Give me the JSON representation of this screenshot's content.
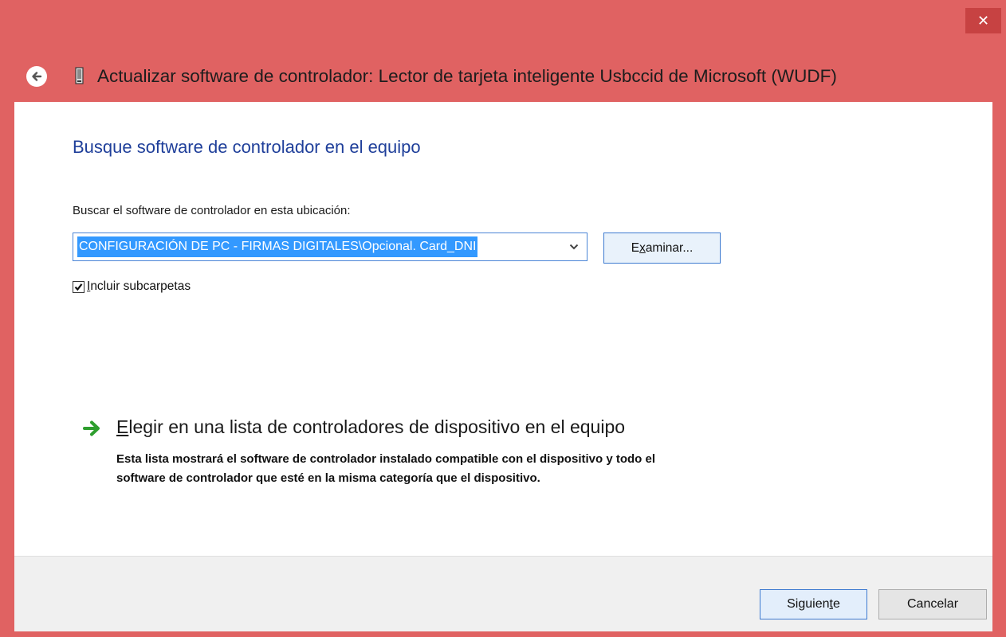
{
  "window": {
    "title": "Actualizar software de controlador: Lector de tarjeta inteligente Usbccid de Microsoft (WUDF)",
    "close_glyph": "✕",
    "back_icon": "back-arrow-icon",
    "device_icon": "smart-card-reader-icon",
    "accent_color": "#e06262"
  },
  "main": {
    "heading": "Busque software de controlador en el equipo",
    "location_label": "Buscar el software de controlador en esta ubicación:",
    "location_value": "CONFIGURACIÓN DE PC - FIRMAS DIGITALES\\Opcional. Card_DNI",
    "browse_button": {
      "pre": "E",
      "mnemonic": "x",
      "post": "aminar..."
    },
    "include_subfolders": {
      "checked": true,
      "mnemonic": "I",
      "post": "ncluir subcarpetas"
    },
    "pick_option": {
      "title_mnemonic": "E",
      "title_post": "legir en una lista de controladores de dispositivo en el equipo",
      "description_line1": "Esta lista mostrará el software de controlador instalado compatible con el dispositivo y todo el",
      "description_line2": "software de controlador que esté en la misma categoría que el dispositivo."
    }
  },
  "footer": {
    "next_button": {
      "pre": "Siguien",
      "mnemonic": "t",
      "post": "e"
    },
    "cancel_button": "Cancelar"
  }
}
